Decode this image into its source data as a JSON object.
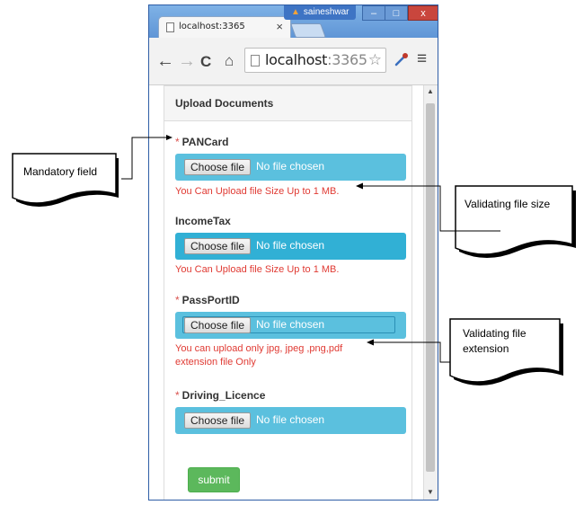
{
  "browser": {
    "tab_title": "localhost:3365",
    "tab_close": "×",
    "user_name": "saineshwar",
    "url_host": "localhost",
    "url_port": ":3365",
    "window_buttons": {
      "minimize": "–",
      "maximize": "□",
      "close": "x"
    },
    "nav": {
      "back": "←",
      "forward": "→",
      "reload": "C",
      "home": "⌂",
      "star": "☆",
      "menu": "≡"
    }
  },
  "form": {
    "heading": "Upload Documents",
    "required_mark": "*",
    "choose_label": "Choose file",
    "no_file_text": "No file chosen",
    "fields": [
      {
        "label": "PANCard",
        "required": true,
        "error": "You Can Upload file Size Up to 1 MB."
      },
      {
        "label": "IncomeTax",
        "required": false,
        "error": "You Can Upload file Size Up to 1 MB."
      },
      {
        "label": "PassPortID",
        "required": true,
        "error_line1": "You can upload only jpg, jpeg ,png,pdf",
        "error_line2": "extension file Only"
      },
      {
        "label": "Driving_Licence",
        "required": true
      }
    ],
    "submit_label": "submit"
  },
  "annotations": {
    "mandatory": "Mandatory field",
    "file_size": "Validating file size",
    "extension_line1": "Validating file",
    "extension_line2": "extension"
  },
  "colors": {
    "file_box": "#5bc0de",
    "file_box_dark": "#31b0d5",
    "error_text": "#e03a33",
    "submit": "#5cb85c",
    "required": "#d9534f"
  }
}
